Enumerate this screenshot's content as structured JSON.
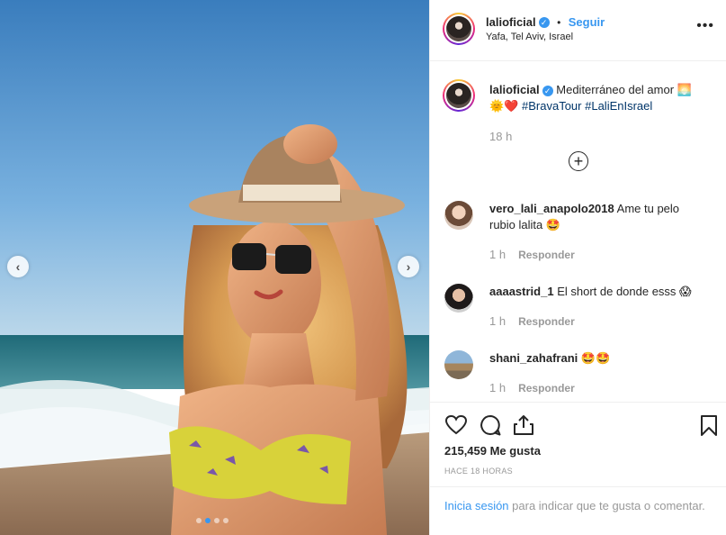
{
  "media": {
    "prev_icon": "chevron-left-icon",
    "next_icon": "chevron-right-icon",
    "carousel_dots": 4,
    "active_dot": 1
  },
  "header": {
    "username": "lalioficial",
    "separator": "•",
    "follow_label": "Seguir",
    "location": "Yafa, Tel Aviv, Israel",
    "more_icon": "more-options-icon"
  },
  "caption": {
    "username": "lalioficial",
    "text": "Mediterráneo del amor",
    "emoji_line": "🌞❤️",
    "hashtags": [
      "#BravaTour",
      "#LaliEnIsrael"
    ],
    "time": "18 h"
  },
  "load_more_icon": "plus-circle-icon",
  "comments": [
    {
      "username": "vero_lali_anapolo2018",
      "text": "Ame tu pelo rubio lalita 🤩",
      "time": "1 h",
      "reply_label": "Responder"
    },
    {
      "username": "aaaastrid_1",
      "text": "El short de donde esss 😱",
      "time": "1 h",
      "reply_label": "Responder"
    },
    {
      "username": "shani_zahafrani",
      "text": "🤩🤩",
      "time": "1 h",
      "reply_label": "Responder"
    }
  ],
  "actions": {
    "like_icon": "heart-icon",
    "comment_icon": "comment-icon",
    "share_icon": "share-icon",
    "save_icon": "bookmark-icon",
    "likes": "215,459 Me gusta",
    "time_ago": "HACE 18 HORAS"
  },
  "login": {
    "link": "Inicia sesión",
    "rest": " para indicar que te gusta o comentar."
  },
  "colors": {
    "accent": "#3897f0",
    "hashtag": "#003569",
    "heart": "#e0245e",
    "sky": "#4a90c8"
  }
}
